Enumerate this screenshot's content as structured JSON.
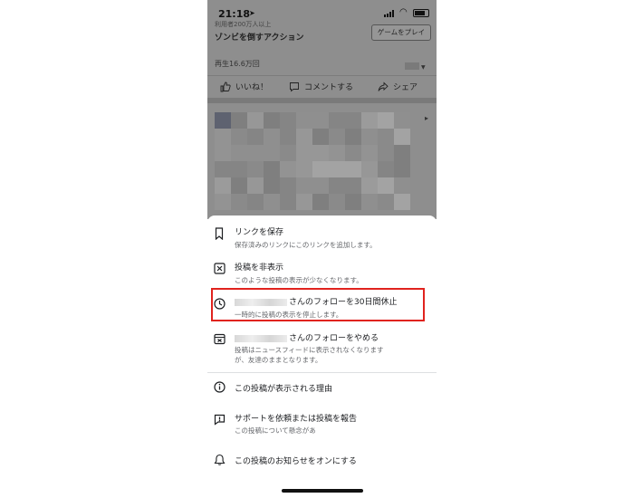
{
  "status_bar": {
    "time": "21:18"
  },
  "background_post": {
    "subtitle": "利用者200万人以上",
    "title": "ゾンビを倒すアクション",
    "play_button": "ゲームをプレイ",
    "views": "再生16.6万回",
    "actions": {
      "like": "いいね！",
      "comment": "コメントする",
      "share": "シェア"
    }
  },
  "menu": {
    "save_link": {
      "title": "リンクを保存",
      "sub": "保存済みのリンクにこのリンクを追加します。"
    },
    "hide_post": {
      "title": "投稿を非表示",
      "sub": "このような投稿の表示が少なくなります。"
    },
    "snooze": {
      "title": "さんのフォローを30日間休止",
      "sub": "一時的に投稿の表示を停止します。"
    },
    "unfollow": {
      "title": "さんのフォローをやめる",
      "sub1": "投稿はニュースフィードに表示されなくなります",
      "sub2": "が、友達のままとなります。"
    },
    "why_seeing": {
      "title": "この投稿が表示される理由"
    },
    "report": {
      "title": "サポートを依頼または投稿を報告",
      "sub": "この投稿について懸念があ"
    },
    "notifications": {
      "title": "この投稿のお知らせをオンにする"
    }
  },
  "colors": {
    "highlight": "#e0231e",
    "dim_overlay": "#8e8e8e"
  }
}
